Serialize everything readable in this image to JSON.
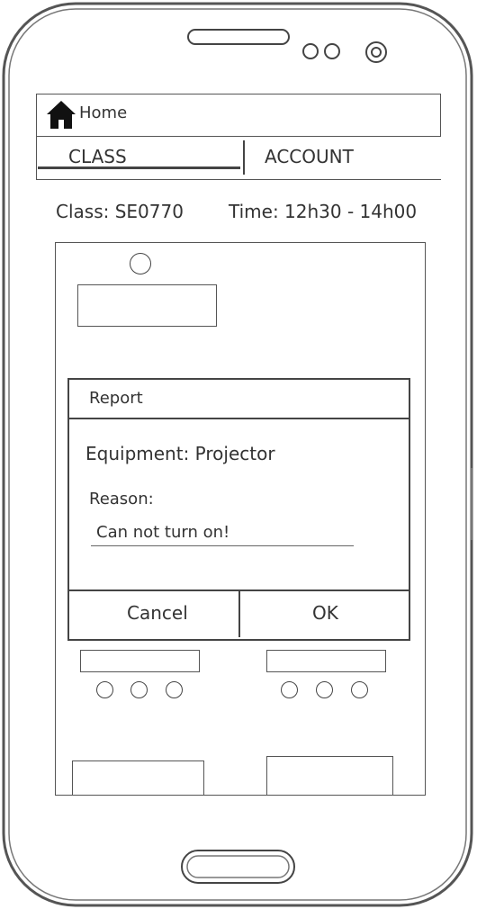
{
  "header": {
    "title": "Home",
    "icon": "home-icon"
  },
  "tabs": [
    {
      "label": "CLASS",
      "active": true
    },
    {
      "label": "ACCOUNT",
      "active": false
    }
  ],
  "class_info": {
    "class_text": "Class: SE0770",
    "time_text": "Time: 12h30 - 14h00"
  },
  "dialog": {
    "title": "Report",
    "equipment_text": "Equipment: Projector",
    "reason_label": "Reason:",
    "reason_value": "Can not turn on!",
    "cancel_label": "Cancel",
    "ok_label": "OK"
  }
}
